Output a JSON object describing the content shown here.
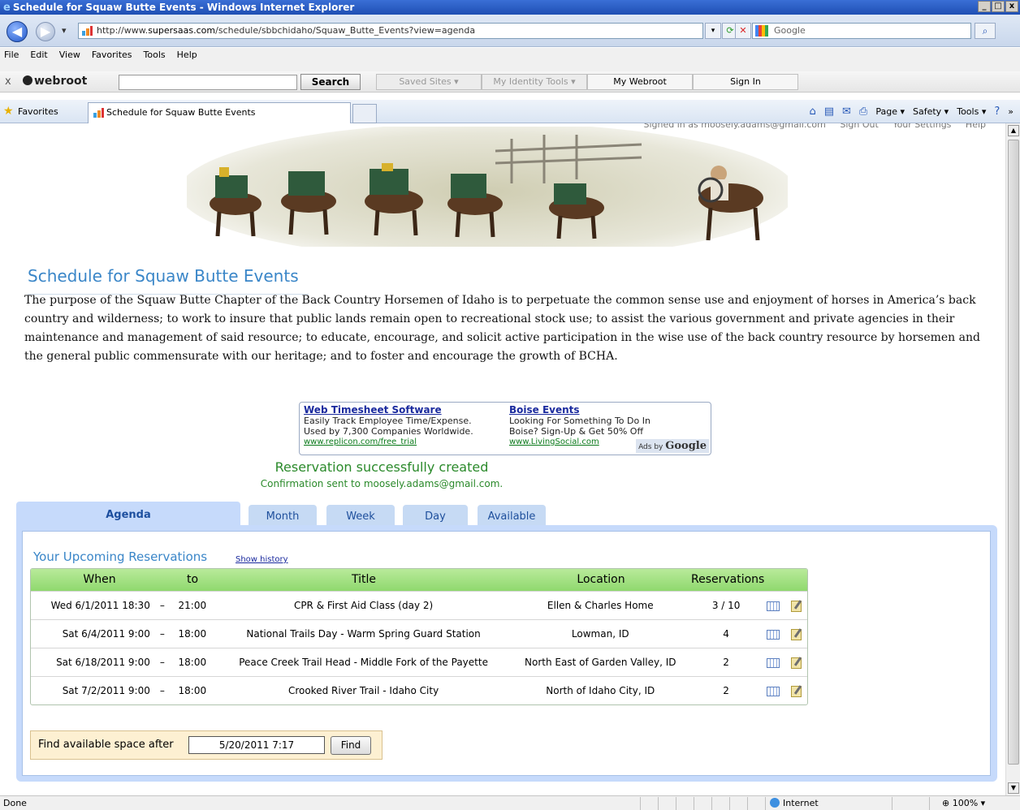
{
  "window": {
    "title": "Schedule for Squaw Butte Events - Windows Internet Explorer",
    "ie_logo": "e",
    "min": "_",
    "max": "□",
    "close": "x"
  },
  "address": {
    "back": "◀",
    "forward": "▶",
    "dropdown": "▾",
    "url_prefix": "http://www.",
    "url_domain": "supersaas.com",
    "url_path": "/schedule/sbbchidaho/Squaw_Butte_Events?view=agenda",
    "refresh": "⟳",
    "stop": "✕",
    "search_placeholder": "Google",
    "search_button": "⌕"
  },
  "menu": [
    "File",
    "Edit",
    "View",
    "Favorites",
    "Tools",
    "Help"
  ],
  "webroot": {
    "close": "x",
    "logo": "webroot",
    "search_button": "Search",
    "saved_sites": "Saved Sites",
    "identity_tools": "My Identity Tools",
    "my_webroot": "My Webroot",
    "sign_in": "Sign In"
  },
  "favorites_bar": {
    "star": "★",
    "label": "Favorites",
    "tab_title": "Schedule for Squaw Butte Events",
    "home": "⌂",
    "page": "Page",
    "safety": "Safety",
    "tools": "Tools",
    "help": "?",
    "more": "»"
  },
  "top_links": {
    "signed_in": "Signed in as moosely.adams@gmail.com",
    "sign_out": "Sign Out",
    "settings": "Your Settings",
    "help": "Help"
  },
  "page": {
    "title": "Schedule for Squaw Butte Events",
    "description": "The purpose of the Squaw Butte Chapter of the Back Country Horsemen of Idaho is to perpetuate the common sense use and enjoyment of horses in America’s back country and wilderness; to work to insure that public lands remain open to recreational stock use; to assist the various government and private agencies in their maintenance and management of said resource; to educate, encourage, and solicit active participation in the wise use of the back country resource by horsemen and the general public commensurate with our heritage; and to foster and encourage the growth of BCHA."
  },
  "ads": [
    {
      "title": "Web Timesheet Software",
      "line1": "Easily Track Employee Time/Expense.",
      "line2": "Used by 7,300 Companies Worldwide.",
      "url": "www.replicon.com/free_trial"
    },
    {
      "title": "Boise Events",
      "line1": "Looking For Something To Do In",
      "line2": "Boise? Sign-Up & Get 50% Off",
      "url": "www.LivingSocial.com"
    }
  ],
  "ads_by": {
    "prefix": "Ads by",
    "brand": "Google"
  },
  "messages": {
    "success": "Reservation successfully created",
    "confirmation": "Confirmation sent to moosely.adams@gmail.com."
  },
  "tabs": [
    "Agenda",
    "Month",
    "Week",
    "Day",
    "Available"
  ],
  "reservations": {
    "title": "Your Upcoming Reservations",
    "show_history": "Show history",
    "headers": {
      "when": "When",
      "to": "to",
      "title": "Title",
      "location": "Location",
      "reservations": "Reservations"
    },
    "dash": "–",
    "rows": [
      {
        "when": "Wed 6/1/2011 18:30",
        "to": "21:00",
        "title": "CPR & First Aid Class (day 2)",
        "location": "Ellen & Charles Home",
        "count": "3 / 10"
      },
      {
        "when": "Sat 6/4/2011 9:00",
        "to": "18:00",
        "title": "National Trails Day - Warm Spring Guard Station",
        "location": "Lowman, ID",
        "count": "4"
      },
      {
        "when": "Sat 6/18/2011 9:00",
        "to": "18:00",
        "title": "Peace Creek Trail Head - Middle Fork of the Payette",
        "location": "North East of Garden Valley, ID",
        "count": "2"
      },
      {
        "when": "Sat 7/2/2011 9:00",
        "to": "18:00",
        "title": "Crooked River Trail - Idaho City",
        "location": "North of Idaho City, ID",
        "count": "2"
      }
    ]
  },
  "find": {
    "label": "Find available space after",
    "value": "5/20/2011 7:17",
    "button": "Find"
  },
  "status": {
    "left": "Done",
    "zone": "Internet",
    "zoom": "100%"
  },
  "colors": {
    "title_blue": "#3a86c8",
    "success_green": "#2b8a2b",
    "tab_blue": "#c6dafb",
    "header_green": "#8fd86e"
  }
}
